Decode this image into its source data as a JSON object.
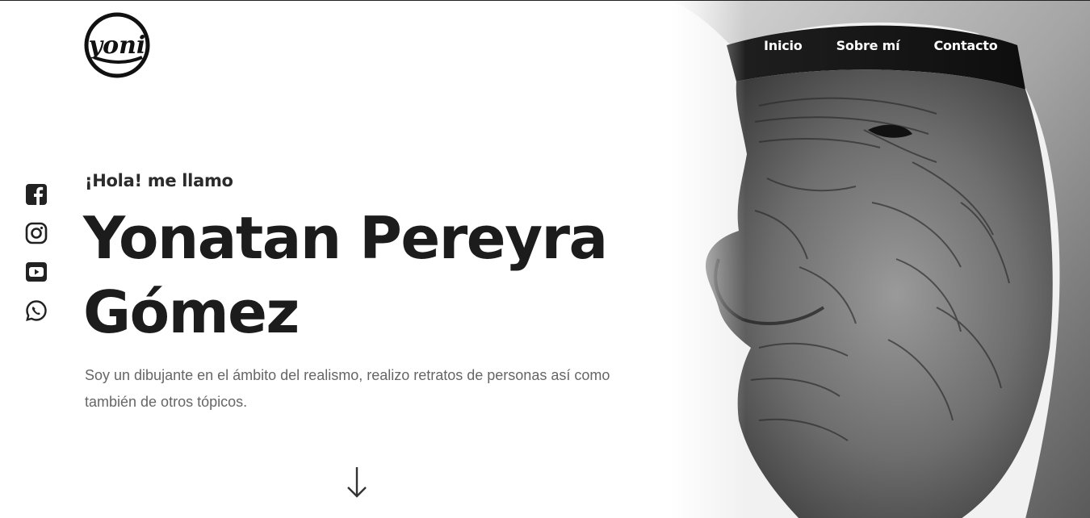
{
  "logo": {
    "text": "yoni"
  },
  "nav": {
    "items": [
      {
        "label": "Inicio"
      },
      {
        "label": "Sobre mí"
      },
      {
        "label": "Contacto"
      }
    ]
  },
  "social": [
    {
      "icon": "facebook-icon"
    },
    {
      "icon": "instagram-icon"
    },
    {
      "icon": "youtube-icon"
    },
    {
      "icon": "whatsapp-icon"
    }
  ],
  "hero": {
    "greeting": "¡Hola! me llamo",
    "name": "Yonatan Pereyra Gómez",
    "intro": "Soy un dibujante en el ámbito del realismo, realizo retratos de personas así como también de otros tópicos."
  },
  "colors": {
    "text_dark": "#1c1c1c",
    "text_muted": "#666666",
    "nav_text": "#ffffff"
  }
}
